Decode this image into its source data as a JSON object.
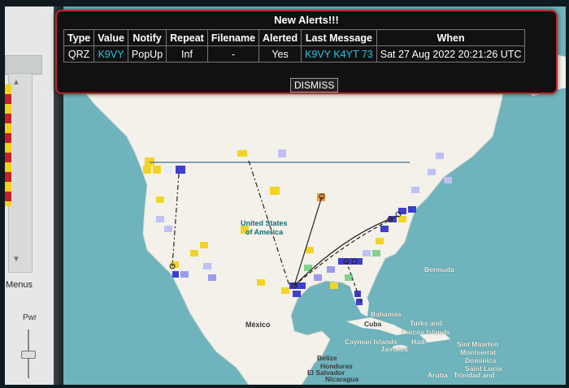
{
  "alert": {
    "title": "New Alerts!!!",
    "columns": [
      "Type",
      "Value",
      "Notify",
      "Repeat",
      "Filename",
      "Alerted",
      "Last Message",
      "When"
    ],
    "row": {
      "type": "QRZ",
      "value": "K9VY",
      "notify": "PopUp",
      "repeat": "Inf",
      "filename": "-",
      "alerted": "Yes",
      "last_message": "K9VY K4YT 73",
      "when": "Sat 27 Aug 2022 20:21:26 UTC"
    },
    "dismiss_label": "DISMISS"
  },
  "left_panel": {
    "menus_label": "Menus",
    "pwr_label": "Pwr"
  },
  "map": {
    "labels": {
      "us_line1": "United States",
      "us_line2": "of America",
      "mexico": "México",
      "bermuda": "Bermuda",
      "bahamas": "Bahamas",
      "cuba": "Cuba",
      "turks": "Turks and",
      "caicos": "Caicos Islands",
      "cayman": "Cayman Islands",
      "haiti": "Haiti",
      "jamaica": "Jamaica",
      "sint_maarten": "Sint Maarten",
      "montserrat": "Montserrat",
      "dominica": "Dominica",
      "saint_lucia": "Saint Lucia",
      "belize": "Belize",
      "honduras": "Honduras",
      "el_salvador": "El Salvador",
      "nicaragua": "Nicaragua",
      "aruba": "Aruba",
      "trinidad": "Trinidad and"
    },
    "colors": {
      "ocean": "#6fb4bd",
      "land": "#f3f1ea",
      "spot_blue": "#3f3fcf",
      "spot_yellow": "#f2d427",
      "spot_green": "#7fd48a",
      "spot_orange": "#f09a3c",
      "alert_border": "#c4262b",
      "callsign": "#27c6e0"
    }
  }
}
